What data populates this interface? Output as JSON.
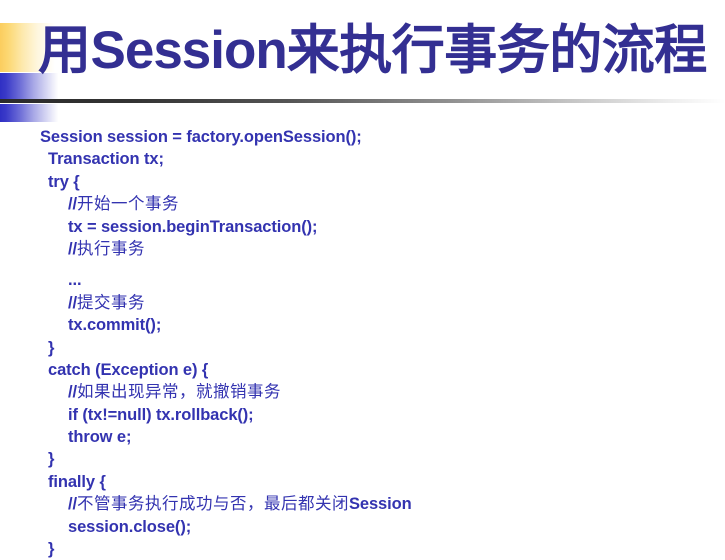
{
  "slide": {
    "title_prefix": "用",
    "title_latin": "Session",
    "title_suffix": "来执行事务的流程",
    "title_full": "用Session来执行事务的流程",
    "colors": {
      "title_blue": "#332f92",
      "code_blue": "#3333b0",
      "deco_gold": "#fbcd5e",
      "deco_blue": "#2f2fc4",
      "rule_dark": "#2b2b2b",
      "background": "#ffffff"
    },
    "decorations": {
      "gold_bar": "gold-gradient-bar",
      "blue_bar_top": "blue-gradient-bar-top",
      "blue_bar_bottom": "blue-gradient-bar-bottom",
      "horizontal_rule": "title-underline-rule"
    }
  },
  "code": {
    "language": "java",
    "lines": [
      {
        "indent": 0,
        "text": "Session session = factory.openSession();",
        "gap_before": false
      },
      {
        "indent": 1,
        "text": "Transaction tx;",
        "gap_before": false
      },
      {
        "indent": 1,
        "text": "try {",
        "gap_before": false
      },
      {
        "indent": 2,
        "text": "//开始一个事务",
        "gap_before": false
      },
      {
        "indent": 2,
        "text": "tx = session.beginTransaction();",
        "gap_before": false
      },
      {
        "indent": 2,
        "text": "//执行事务",
        "gap_before": false
      },
      {
        "indent": 2,
        "text": "...",
        "gap_before": true
      },
      {
        "indent": 2,
        "text": "//提交事务",
        "gap_before": false
      },
      {
        "indent": 2,
        "text": "tx.commit();",
        "gap_before": false
      },
      {
        "indent": 1,
        "text": "}",
        "gap_before": false
      },
      {
        "indent": 1,
        "text": "catch (Exception e) {",
        "gap_before": false
      },
      {
        "indent": 2,
        "text": "//如果出现异常，就撤销事务",
        "gap_before": false
      },
      {
        "indent": 2,
        "text": "if (tx!=null) tx.rollback();",
        "gap_before": false
      },
      {
        "indent": 2,
        "text": "throw e;",
        "gap_before": false
      },
      {
        "indent": 1,
        "text": "}",
        "gap_before": false
      },
      {
        "indent": 1,
        "text": "finally {",
        "gap_before": false
      },
      {
        "indent": 2,
        "text": "//不管事务执行成功与否，最后都关闭Session",
        "gap_before": false
      },
      {
        "indent": 2,
        "text": "session.close();",
        "gap_before": false
      },
      {
        "indent": 1,
        "text": "}",
        "gap_before": false
      }
    ]
  }
}
